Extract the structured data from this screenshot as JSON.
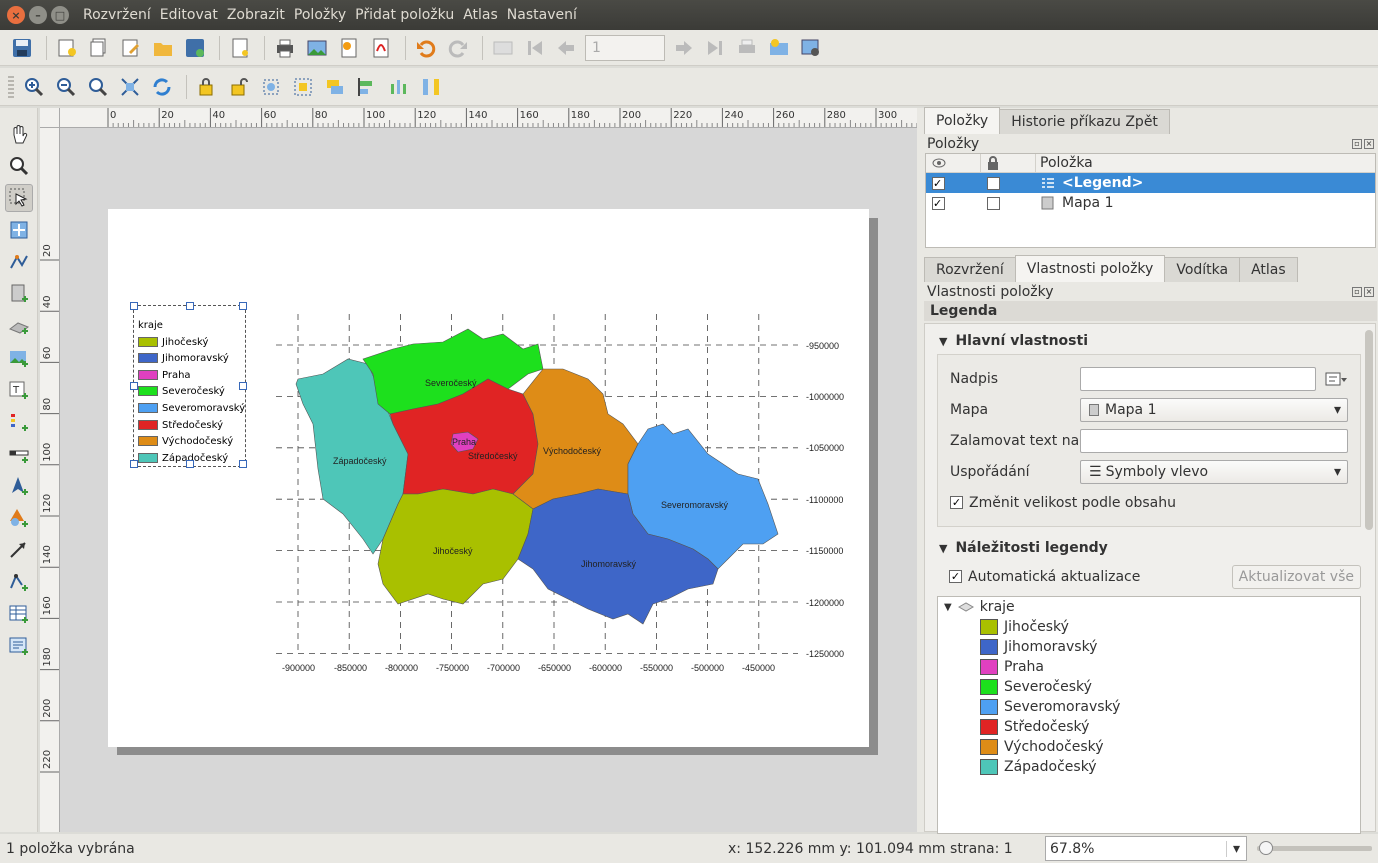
{
  "menubar": {
    "items": [
      "Rozvržení",
      "Editovat",
      "Zobrazit",
      "Položky",
      "Přidat položku",
      "Atlas",
      "Nastavení"
    ]
  },
  "toolbar": {
    "page_value": "1"
  },
  "ruler": {
    "top_ticks": [
      "0",
      "20",
      "40",
      "60",
      "80",
      "100",
      "120",
      "140",
      "160",
      "180",
      "200",
      "220",
      "240",
      "260",
      "280",
      "300"
    ],
    "left_ticks": [
      "20",
      "40",
      "60",
      "80",
      "100",
      "120",
      "140",
      "160",
      "180",
      "200",
      "220"
    ]
  },
  "legend": {
    "title": "kraje",
    "items": [
      {
        "label": "Jihočeský",
        "color": "#a9c000"
      },
      {
        "label": "Jihomoravský",
        "color": "#3e66c8"
      },
      {
        "label": "Praha",
        "color": "#e040c0"
      },
      {
        "label": "Severočeský",
        "color": "#1de01d"
      },
      {
        "label": "Severomoravský",
        "color": "#4ea0f2"
      },
      {
        "label": "Středočeský",
        "color": "#e02424"
      },
      {
        "label": "Východočeský",
        "color": "#de8c17"
      },
      {
        "label": "Západočeský",
        "color": "#4ec6b8"
      }
    ]
  },
  "map": {
    "region_labels": [
      "Severočeský",
      "Západočeský",
      "Praha",
      "Středočeský",
      "Východočeský",
      "Severomoravský",
      "Jihočeský",
      "Jihomoravský"
    ],
    "y_labels": [
      "-950000",
      "-1000000",
      "-1050000",
      "-1100000",
      "-1150000",
      "-1200000",
      "-1250000"
    ],
    "x_labels": [
      "-900000",
      "-850000",
      "-800000",
      "-750000",
      "-700000",
      "-650000",
      "-600000",
      "-550000",
      "-500000",
      "-450000"
    ]
  },
  "right_panel": {
    "tabs_top": [
      "Položky",
      "Historie příkazu Zpět"
    ],
    "items_title": "Položky",
    "items_header": "Položka",
    "items": [
      {
        "name": "<Legend>",
        "visible": true,
        "locked": false
      },
      {
        "name": "Mapa 1",
        "visible": true,
        "locked": false
      }
    ],
    "tabs_bottom": [
      "Rozvržení",
      "Vlastnosti položky",
      "Vodítka",
      "Atlas"
    ],
    "props_title": "Vlastnosti položky",
    "props_subtitle": "Legenda",
    "main_section": "Hlavní vlastnosti",
    "title_label": "Nadpis",
    "title_value": "",
    "map_label": "Mapa",
    "map_value": "Mapa 1",
    "wrap_label": "Zalamovat text na",
    "wrap_value": "",
    "arrange_label": "Uspořádání",
    "arrange_value": "Symboly vlevo",
    "resize_label": "Změnit velikost podle obsahu",
    "items_section": "Náležitosti legendy",
    "auto_update_label": "Automatická aktualizace",
    "update_all_label": "Aktualizovat vše",
    "tree_layer": "kraje"
  },
  "status": {
    "left": "1 položka vybrána",
    "coords": "x: 152.226 mm  y: 101.094 mm  strana: 1",
    "zoom": "67.8%"
  }
}
